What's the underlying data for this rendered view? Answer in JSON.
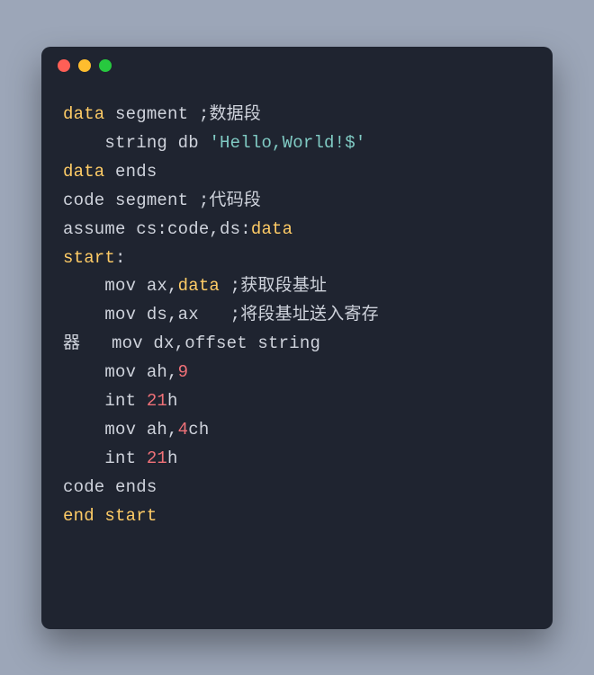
{
  "colors": {
    "background": "#9ca6b8",
    "window": "#1f2430",
    "text": "#cfd3dc",
    "keyword": "#ffcc66",
    "string": "#80cbc4",
    "number": "#f07178",
    "traffic_red": "#ff5f56",
    "traffic_yellow": "#ffbd2e",
    "traffic_green": "#27c93f"
  },
  "traffic_lights": [
    "close",
    "minimize",
    "zoom"
  ],
  "code": {
    "language": "x86-assembly",
    "raw": "data segment ;数据段\n    string db 'Hello,World!$'\ndata ends\ncode segment ;代码段\nassume cs:code,ds:data\nstart:\n    mov ax,data ;获取段基址\n    mov ds,ax   ;将段基址送入寄存\n器   mov dx,offset string\n    mov ah,9\n    int 21h\n    mov ah,4ch\n    int 21h\ncode ends\nend start",
    "tokens": [
      [
        {
          "t": "data",
          "c": "kw"
        },
        {
          "t": " segment ;数据段",
          "c": "comment"
        }
      ],
      [
        {
          "t": "    string db ",
          "c": ""
        },
        {
          "t": "'Hello,World!$'",
          "c": "string"
        }
      ],
      [
        {
          "t": "data",
          "c": "kw"
        },
        {
          "t": " ends",
          "c": ""
        }
      ],
      [
        {
          "t": "code segment ;代码段",
          "c": "comment"
        }
      ],
      [
        {
          "t": "assume cs:code,ds:",
          "c": ""
        },
        {
          "t": "data",
          "c": "kw"
        }
      ],
      [
        {
          "t": "start",
          "c": "kw"
        },
        {
          "t": ":",
          "c": ""
        }
      ],
      [
        {
          "t": "    mov ax,",
          "c": ""
        },
        {
          "t": "data",
          "c": "kw"
        },
        {
          "t": " ;获取段基址",
          "c": "comment"
        }
      ],
      [
        {
          "t": "    mov ds,ax   ;将段基址送入寄存",
          "c": "comment"
        }
      ],
      [
        {
          "t": "器   mov dx,offset string",
          "c": ""
        }
      ],
      [
        {
          "t": "    mov ah,",
          "c": ""
        },
        {
          "t": "9",
          "c": "num"
        }
      ],
      [
        {
          "t": "    int ",
          "c": ""
        },
        {
          "t": "21",
          "c": "num"
        },
        {
          "t": "h",
          "c": ""
        }
      ],
      [
        {
          "t": "    mov ah,",
          "c": ""
        },
        {
          "t": "4",
          "c": "num"
        },
        {
          "t": "ch",
          "c": ""
        }
      ],
      [
        {
          "t": "    int ",
          "c": ""
        },
        {
          "t": "21",
          "c": "num"
        },
        {
          "t": "h",
          "c": ""
        }
      ],
      [
        {
          "t": "code ends",
          "c": ""
        }
      ],
      [
        {
          "t": "end",
          "c": "kw"
        },
        {
          "t": " ",
          "c": ""
        },
        {
          "t": "start",
          "c": "kw"
        }
      ]
    ]
  }
}
